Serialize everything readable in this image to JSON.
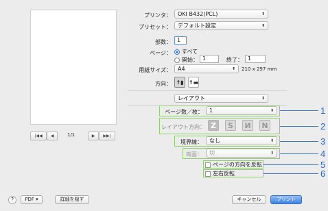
{
  "header": {
    "printer_label": "プリンタ：",
    "printer_value": "OKI B432(PCL)",
    "presets_label": "プリセット：",
    "presets_value": "デフォルト設定"
  },
  "copies": {
    "label": "部数：",
    "value": "1"
  },
  "pages": {
    "label": "ページ：",
    "all_label": "すべて",
    "from_label": "開始：",
    "from_value": "1",
    "to_label": "終了：",
    "to_value": "1"
  },
  "paper_size": {
    "label": "用紙サイズ：",
    "value": "A4",
    "dimensions": "210 x 297 mm"
  },
  "orientation": {
    "label": "方向："
  },
  "section": {
    "value": "レイアウト"
  },
  "preview": {
    "first": "|◀◀",
    "prev": "◀",
    "page_count": "1/1",
    "next": "▶",
    "last": "▶▶|"
  },
  "layout": {
    "pages_per_sheet_label": "ページ数／枚：",
    "pages_per_sheet_value": "1",
    "direction_label": "レイアウト方向：",
    "directions": [
      "Z",
      "S",
      "И",
      "N"
    ],
    "border_label": "境界線：",
    "border_value": "なし",
    "two_sided_label": "両面：",
    "two_sided_value": "切",
    "reverse_orientation_label": "ページの方向を反転",
    "flip_horizontal_label": "左右反転"
  },
  "callouts": [
    "1",
    "2",
    "3",
    "4",
    "5",
    "6"
  ],
  "footer": {
    "help": "?",
    "pdf_label": "PDF ▾",
    "hide_details_label": "詳細を隠す",
    "cancel_label": "キャンセル",
    "print_label": "プリント"
  }
}
